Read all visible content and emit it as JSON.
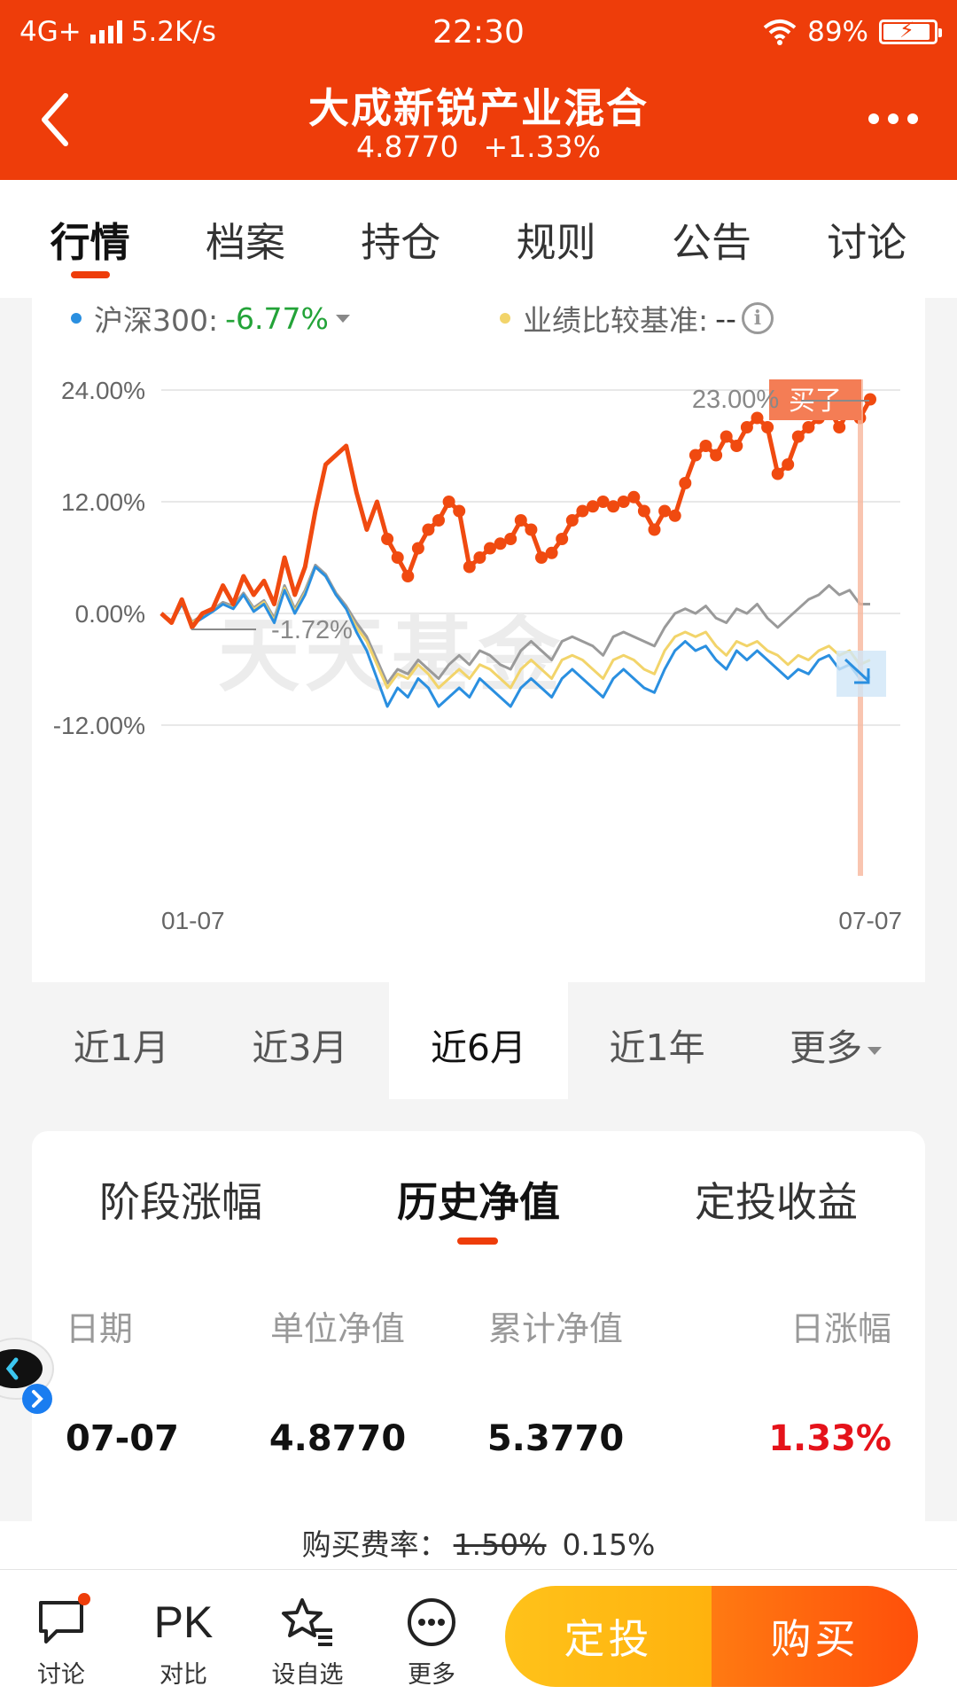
{
  "status_bar": {
    "network": "4G+",
    "speed": "5.2K/s",
    "time": "22:30",
    "battery": "89%"
  },
  "header": {
    "title": "大成新锐产业混合",
    "nav": "4.8770",
    "change": "+1.33%"
  },
  "tabs": [
    {
      "label": "行情",
      "active": true
    },
    {
      "label": "档案"
    },
    {
      "label": "持仓"
    },
    {
      "label": "规则"
    },
    {
      "label": "公告"
    },
    {
      "label": "讨论"
    }
  ],
  "legend": {
    "hs300_label": "沪深300:",
    "hs300_value": "-6.77%",
    "benchmark_label": "业绩比较基准:",
    "benchmark_value": "--"
  },
  "chart_labels": {
    "bought_tag": "买了",
    "max_label": "23.00%",
    "min_label": "-1.72%",
    "watermark": "天天基金"
  },
  "chart_data": {
    "type": "line",
    "y_ticks": [
      "24.00%",
      "12.00%",
      "0.00%",
      "-12.00%"
    ],
    "x_ticks": [
      "01-07",
      "07-07"
    ],
    "ylim": [
      -12,
      24
    ],
    "colors": {
      "fund": "#f04a10",
      "hs300": "#2a8fe0",
      "benchmark": "#f2d46a",
      "gray": "#9a9a9a"
    },
    "series": [
      {
        "key": "fund",
        "values": [
          0,
          -1,
          1.5,
          -1.5,
          0,
          0.5,
          3,
          1,
          4,
          2,
          3.5,
          1,
          6,
          2,
          5,
          11,
          16,
          17,
          18,
          13,
          9,
          12,
          8,
          6,
          4,
          7,
          9,
          10,
          12,
          11,
          5,
          6,
          7,
          7.5,
          8,
          10,
          9,
          6,
          6.5,
          8,
          10,
          11,
          11.5,
          12,
          11.5,
          12,
          12.5,
          11,
          9,
          11,
          10.5,
          14,
          17,
          18,
          17,
          19,
          18,
          20,
          21,
          20,
          15,
          16,
          19,
          20,
          21,
          22,
          20,
          22,
          21,
          23
        ]
      },
      {
        "key": "hs300",
        "values": [
          0,
          -1,
          1,
          -1.2,
          -0.5,
          0.2,
          1,
          0.5,
          2,
          0.2,
          1,
          -1,
          2.5,
          0,
          2,
          5,
          4,
          2,
          0.5,
          -2,
          -4,
          -7,
          -10,
          -8,
          -9,
          -7,
          -8,
          -10,
          -9,
          -8,
          -9,
          -7,
          -8,
          -9,
          -10,
          -8,
          -7,
          -8,
          -9,
          -7,
          -6,
          -7,
          -8,
          -9,
          -7,
          -6,
          -7,
          -8,
          -8.5,
          -6,
          -4,
          -3,
          -4,
          -3.5,
          -5,
          -6,
          -4,
          -5,
          -4,
          -5,
          -6,
          -7,
          -6,
          -6.5,
          -5,
          -4.5,
          -6,
          -5.5,
          -7,
          -6.77
        ]
      },
      {
        "key": "benchmark",
        "values": [
          0,
          -1,
          1,
          -1,
          -0.3,
          0.3,
          1,
          0.6,
          2,
          0.4,
          1.2,
          -0.8,
          2.7,
          0.2,
          2.2,
          5,
          4,
          2,
          0.5,
          -1.5,
          -3,
          -5.5,
          -8,
          -6.5,
          -7,
          -5.5,
          -6.5,
          -8,
          -7,
          -6,
          -7,
          -5.5,
          -6,
          -7,
          -8,
          -6,
          -5,
          -6,
          -7,
          -5,
          -4.5,
          -5,
          -6,
          -7,
          -5,
          -4.5,
          -5,
          -6,
          -6.5,
          -4,
          -2.5,
          -2,
          -2.5,
          -2,
          -3.5,
          -4.5,
          -3,
          -3.5,
          -3,
          -4,
          -4.5,
          -5.5,
          -4.5,
          -5,
          -4,
          -3.5,
          -4.5,
          -4,
          -5.5,
          -5
        ]
      },
      {
        "key": "gray",
        "values": [
          0,
          -0.8,
          1.1,
          -0.9,
          -0.2,
          0.4,
          1.2,
          0.8,
          2.2,
          0.6,
          1.4,
          -0.5,
          3,
          0.5,
          2.5,
          5.2,
          4.2,
          2.2,
          0.8,
          -1,
          -2.5,
          -5,
          -7.5,
          -6,
          -6.5,
          -5,
          -6,
          -7,
          -5.5,
          -4.5,
          -5.5,
          -4,
          -4.5,
          -5.5,
          -6,
          -4,
          -3,
          -4,
          -5,
          -3,
          -2.5,
          -3,
          -3.5,
          -4.5,
          -2.5,
          -2,
          -2.5,
          -3,
          -3.5,
          -1.5,
          0,
          0.5,
          0,
          0.8,
          -0.5,
          -1,
          0.5,
          0,
          1,
          -0.5,
          -1.5,
          -0.5,
          0.5,
          1.5,
          2,
          3,
          2,
          2.5,
          1,
          1
        ]
      }
    ]
  },
  "range_tabs": [
    {
      "label": "近1月"
    },
    {
      "label": "近3月"
    },
    {
      "label": "近6月",
      "active": true
    },
    {
      "label": "近1年"
    },
    {
      "label": "更多"
    }
  ],
  "nav_section": {
    "subtabs": [
      {
        "label": "阶段涨幅"
      },
      {
        "label": "历史净值",
        "active": true
      },
      {
        "label": "定投收益"
      }
    ],
    "columns": [
      "日期",
      "单位净值",
      "累计净值",
      "日涨幅"
    ],
    "rows": [
      {
        "date": "07-07",
        "unit_nav": "4.8770",
        "acc_nav": "5.3770",
        "daily_change": "1.33%"
      }
    ]
  },
  "fee": {
    "label": "购买费率：",
    "original": "1.50%",
    "current": "0.15%"
  },
  "bottom_bar": {
    "items": [
      {
        "label": "讨论",
        "icon": "chat-bubble-icon"
      },
      {
        "label": "对比",
        "icon_text": "PK"
      },
      {
        "label": "设自选",
        "icon": "star-list-icon"
      },
      {
        "label": "更多",
        "icon": "more-circle-icon"
      }
    ],
    "sip_button": "定投",
    "buy_button": "购买"
  }
}
